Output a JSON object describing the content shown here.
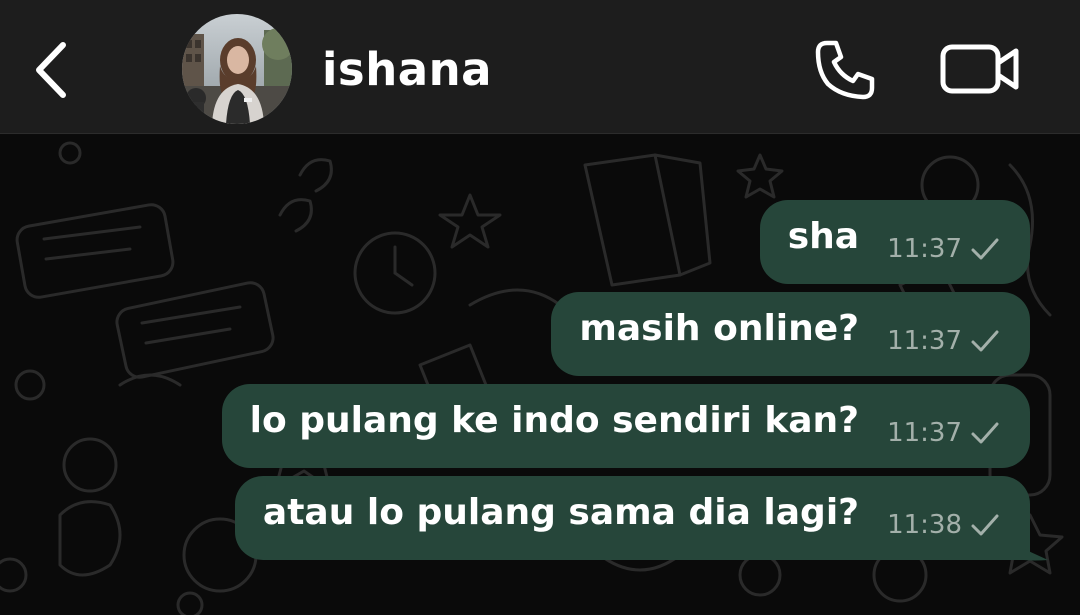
{
  "header": {
    "contact_name": "ishana"
  },
  "icons": {
    "back": "chevron-left-icon",
    "call": "phone-icon",
    "video": "video-camera-icon",
    "status": "single-check-icon"
  },
  "colors": {
    "header_bg": "#1d1d1d",
    "chat_bg": "#0a0a0a",
    "bubble_bg": "#26463a",
    "text": "#ffffff",
    "meta_text": "#a3b0aa"
  },
  "messages": [
    {
      "text": "sha",
      "time": "11:37",
      "status": "sent"
    },
    {
      "text": "masih online?",
      "time": "11:37",
      "status": "sent"
    },
    {
      "text": "lo pulang ke indo sendiri kan?",
      "time": "11:37",
      "status": "sent"
    },
    {
      "text": "atau lo pulang sama dia lagi?",
      "time": "11:38",
      "status": "sent"
    }
  ]
}
